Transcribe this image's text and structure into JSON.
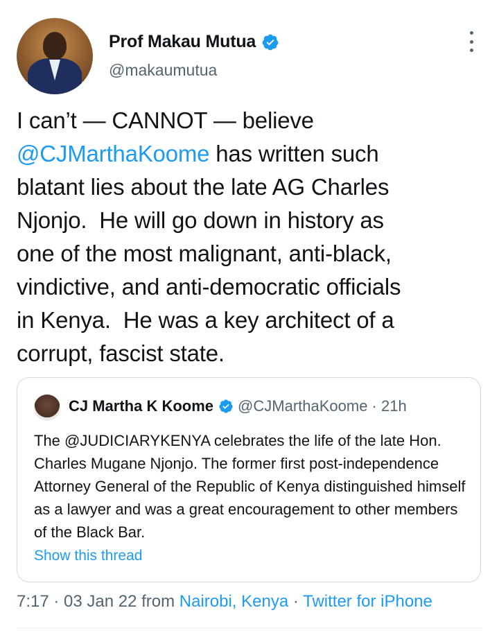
{
  "author": {
    "name": "Prof Makau Mutua",
    "handle": "@makaumutua"
  },
  "tweet": {
    "line1_pre": "I can’t — CANNOT — believe",
    "mention": "@CJMarthaKoome",
    "rest": " has written such\nblatant lies about the late AG Charles\nNjonjo.  He will go down in history as\none of the most malignant, anti-black,\nvindictive, and anti-democratic officials\nin Kenya.  He was a key architect of a\ncorrupt, fascist state."
  },
  "quote": {
    "name": "CJ Martha K Koome",
    "handle_time": "@CJMarthaKoome · 21h",
    "text": "The @JUDICIARYKENYA  celebrates the life of the late Hon. Charles Mugane Njonjo. The former first post-independence Attorney General of the Republic of Kenya distinguished himself as a lawyer and was a great encouragement to other members of the Black Bar.",
    "show_thread": "Show this thread"
  },
  "meta": {
    "time": "7:17 · 03 Jan 22 from ",
    "location": "Nairobi, Kenya",
    "separator": " · ",
    "source": "Twitter for iPhone"
  },
  "colors": {
    "accent": "#1d9bf0",
    "secondary_text": "#536471",
    "border": "#cfd9de"
  },
  "icons": {
    "verified": "verified-badge-icon",
    "more": "more-options-icon"
  }
}
